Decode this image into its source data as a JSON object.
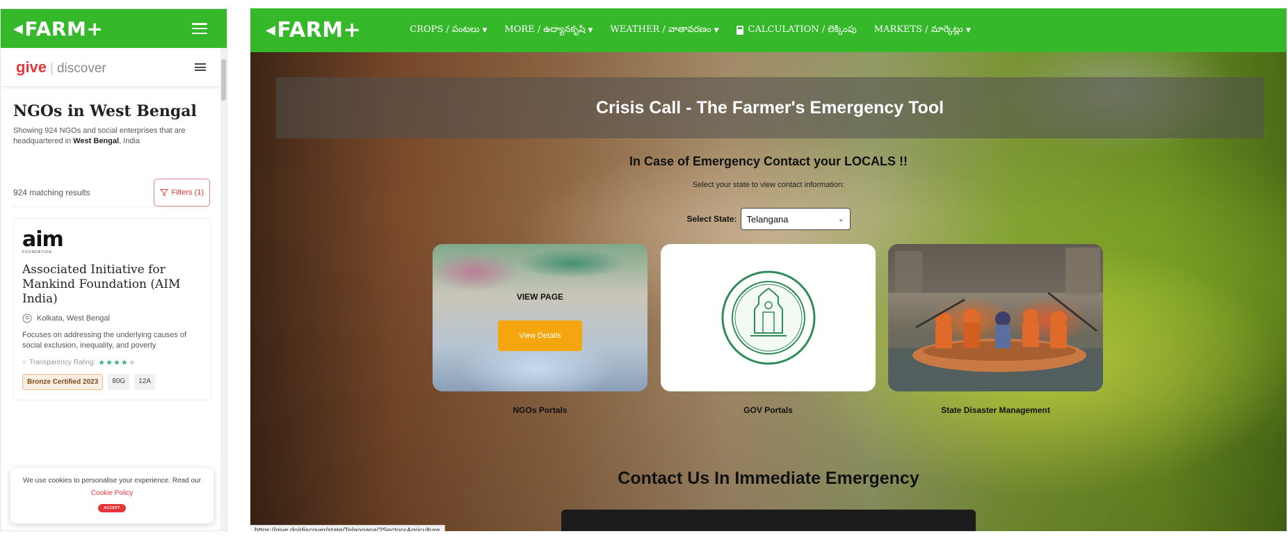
{
  "mobile": {
    "brand": "FARM+",
    "site": {
      "give": "give",
      "sep": "|",
      "discover": "discover"
    },
    "title": "NGOs in West Bengal",
    "subtitle_prefix": "Showing 924 NGOs and social enterprises that are headquartered in ",
    "subtitle_state": "West Bengal",
    "subtitle_suffix": ", India",
    "results_count": "924 matching results",
    "filters_label": "Filters (1)",
    "card": {
      "logo_text": "aim",
      "logo_sub": "FOUNDATION",
      "name": "Associated Initiative for Mankind Foundation (AIM India)",
      "location": "Kolkata, West Bengal",
      "description": "Focuses on addressing the underlying causes of social exclusion, inequality, and poverty",
      "rating_label": "Transparency Rating:",
      "stars_on": "★★★★",
      "stars_off": "★",
      "badges": [
        "Bronze Certified 2023",
        "80G",
        "12A"
      ]
    },
    "cookie": {
      "text": "We use cookies to personalise your experience. Read our",
      "link": "Cookie Policy",
      "accept": "ACCEPT"
    }
  },
  "desktop": {
    "brand": "FARM+",
    "nav": [
      {
        "label": "CROPS / పంటలు"
      },
      {
        "label": "MORE / ఉద్యానకృషి"
      },
      {
        "label": "WEATHER / వాతావరణం"
      },
      {
        "label": "CALCULATION / లెక్కింపు"
      },
      {
        "label": "MARKETS / మార్కెట్లు"
      }
    ],
    "hero_title": "Crisis Call - The Farmer's Emergency Tool",
    "emergency_heading": "In Case of Emergency Contact your LOCALS !!",
    "select_hint": "Select your state to view contact information:",
    "state_label": "Select State:",
    "state_value": "Telangana",
    "tiles": {
      "ngo_overlay": "VIEW PAGE",
      "ngo_button": "View Details",
      "ngo_caption": "NGOs Portals",
      "gov_caption": "GOV Portals",
      "sdm_caption": "State Disaster Management"
    },
    "contact_title": "Contact Us In Immediate Emergency",
    "status_url": "https://give.do/discover/state/Telangana/?Sector=Agriculture"
  },
  "colors": {
    "brand_green": "#35b82a",
    "give_red": "#e5363b",
    "button_orange": "#f5a50e"
  }
}
